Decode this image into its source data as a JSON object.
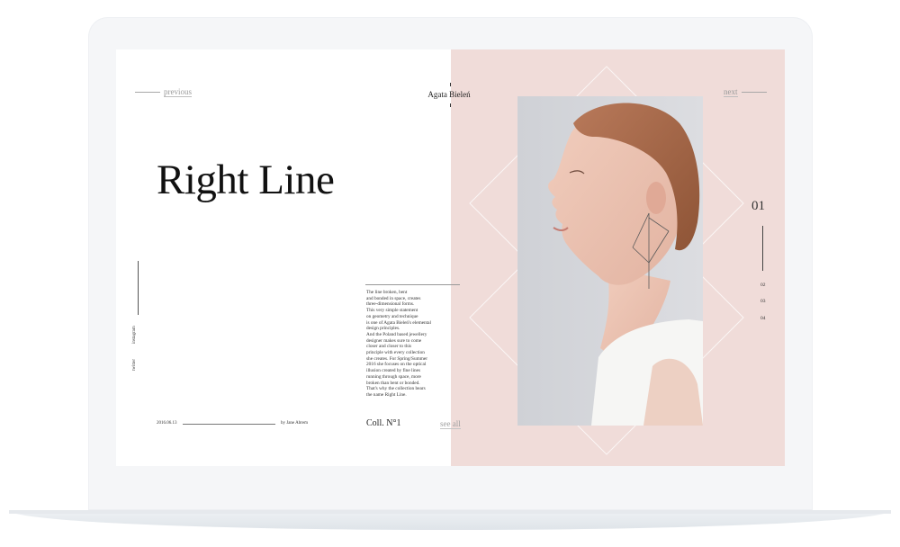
{
  "nav": {
    "previous_label": "previous",
    "next_label": "next"
  },
  "brand": "Agata Bieleń",
  "headline": "Right Line",
  "social": {
    "instagram": "instagram",
    "twitter": "twitter"
  },
  "body_lines": [
    "The line broken, bent",
    "and bonded in space, creates",
    "three-dimensional forms.",
    "This very simple statement",
    "on geometry and technique",
    "is one of Agata Bieleń's elemental",
    "design principles.",
    "And the Poland based jewellery",
    "designer makes sure to come",
    "closer and closer to this",
    "principle with every collection",
    "she creates. For Spring/Summer",
    "2016 she focuses on the optical",
    "illusion created by fine lines",
    "running through space, more",
    "broken than bent or bonded.",
    "That's why the collection bears",
    "the name Right Line."
  ],
  "footer": {
    "date": "2016.06.13",
    "byline": "by Jane Abrem",
    "collection": "Coll. N°1",
    "see_all": "see all"
  },
  "pager": {
    "current": "01",
    "items": [
      "02",
      "03",
      "04"
    ]
  },
  "colors": {
    "panel": "#f0dcd9",
    "photo_bg": "#d6d8dc"
  }
}
